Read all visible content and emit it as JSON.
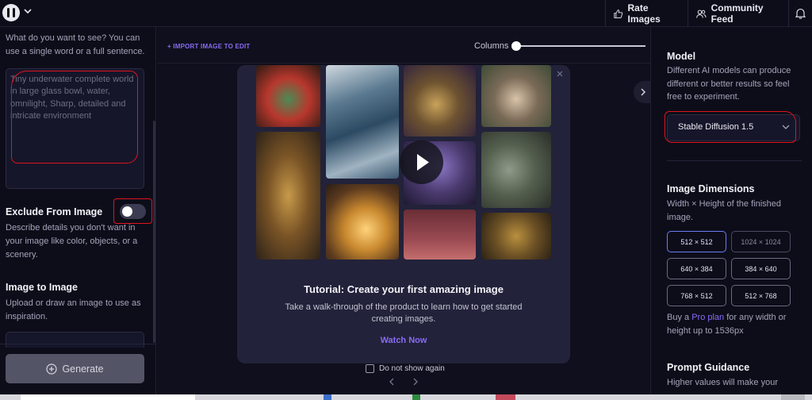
{
  "topbar": {
    "rate_images": "Rate Images",
    "community_feed": "Community Feed"
  },
  "left": {
    "prompt_help": "What do you want to see? You can use a single word or a full sentence.",
    "prompt_placeholder": "Tiny underwater complete world in large glass bowl, water, omnilight, Sharp, detailed and intricate environment",
    "exclude_heading": "Exclude From Image",
    "exclude_toggle_on": false,
    "exclude_help": "Describe details you don't want in your image like color, objects, or a scenery.",
    "img2img_heading": "Image to Image",
    "img2img_help": "Upload or draw an image to use as inspiration.",
    "generate_label": "Generate"
  },
  "center": {
    "import_link": "+ IMPORT IMAGE TO EDIT",
    "columns_label": "Columns",
    "columns_value": 0
  },
  "modal": {
    "title": "Tutorial: Create your first amazing image",
    "description": "Take a walk-through of the product to learn how to get started creating images.",
    "watch_now": "Watch Now",
    "dont_show_again": "Do not show again"
  },
  "right": {
    "model_heading": "Model",
    "model_help": "Different AI models can produce different or better results so feel free to experiment.",
    "model_selected": "Stable Diffusion 1.5",
    "dimensions_heading": "Image Dimensions",
    "dimensions_help": "Width × Height of the finished image.",
    "dimensions": [
      "512 × 512",
      "1024 × 1024",
      "640 × 384",
      "384 × 640",
      "768 × 512",
      "512 × 768"
    ],
    "dimensions_selected": "512 × 512",
    "pro_prefix": "Buy a ",
    "pro_link": "Pro plan",
    "pro_suffix": " for any width or height up to 1536px",
    "guidance_heading": "Prompt Guidance",
    "guidance_help": "Higher values will make your"
  },
  "colors": {
    "accent": "#8a6bf5",
    "annotation": "#e0141c",
    "background": "#0b0b17"
  }
}
